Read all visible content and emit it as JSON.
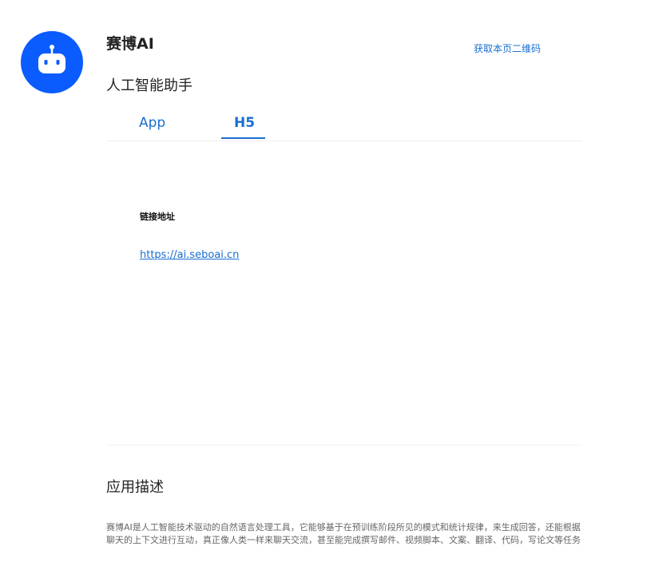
{
  "app": {
    "name": "赛博AI",
    "subtitle": "人工智能助手",
    "logo_icon": "robot-icon",
    "brand_color": "#0a5cff"
  },
  "header": {
    "qr_link": "获取本页二维码"
  },
  "tabs": [
    {
      "label": "App",
      "active": false
    },
    {
      "label": "H5",
      "active": true
    }
  ],
  "h5_panel": {
    "link_label": "链接地址",
    "link_url": "https://ai.seboai.cn"
  },
  "description": {
    "title": "应用描述",
    "text": "赛博AI是人工智能技术驱动的自然语言处理工具，它能够基于在预训练阶段所见的模式和统计规律，来生成回答，还能根据聊天的上下文进行互动，真正像人类一样来聊天交流，甚至能完成撰写邮件、视频脚本、文案、翻译、代码，写论文等任务"
  },
  "colors": {
    "accent": "#1a6fd0",
    "text": "#222222",
    "muted": "#666666"
  }
}
